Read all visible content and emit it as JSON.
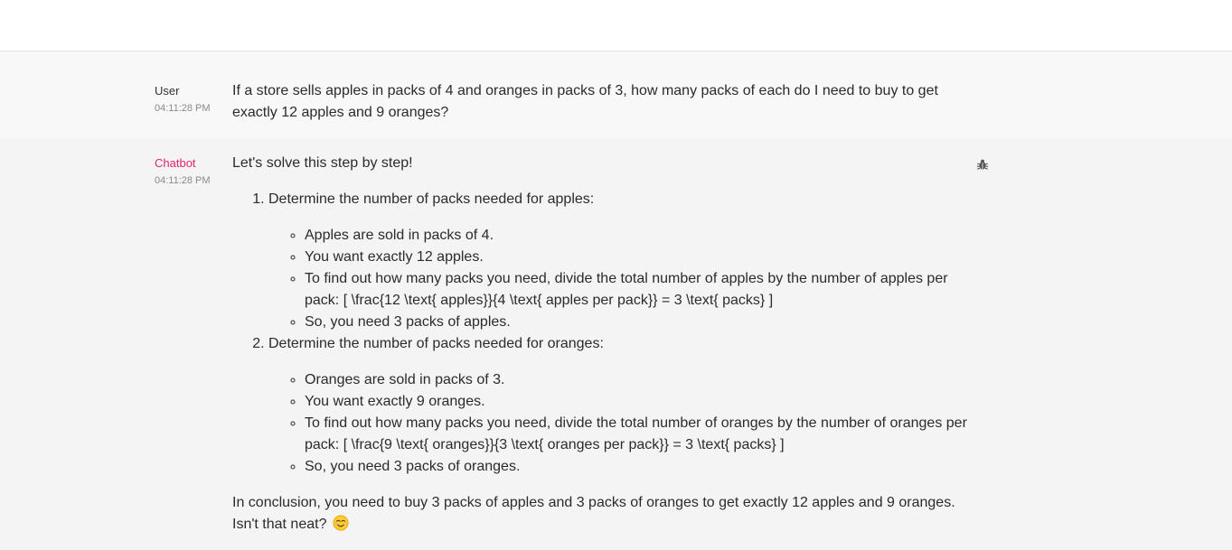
{
  "conversation": {
    "user_message": {
      "author": "User",
      "time": "04:11:28 PM",
      "text": "If a store sells apples in packs of 4 and oranges in packs of 3, how many packs of each do I need to buy to get exactly 12 apples and 9 oranges?"
    },
    "bot_message": {
      "author": "Chatbot",
      "time": "04:11:28 PM",
      "intro": "Let's solve this step by step!",
      "steps": [
        {
          "heading": "Determine the number of packs needed for apples:",
          "bullets": [
            "Apples are sold in packs of 4.",
            "You want exactly 12 apples.",
            "To find out how many packs you need, divide the total number of apples by the number of apples per pack: [ \\frac{12 \\text{ apples}}{4 \\text{ apples per pack}} = 3 \\text{ packs} ]",
            "So, you need 3 packs of apples."
          ]
        },
        {
          "heading": "Determine the number of packs needed for oranges:",
          "bullets": [
            "Oranges are sold in packs of 3.",
            "You want exactly 9 oranges.",
            "To find out how many packs you need, divide the total number of oranges by the number of oranges per pack: [ \\frac{9 \\text{ oranges}}{3 \\text{ oranges per pack}} = 3 \\text{ packs} ]",
            "So, you need 3 packs of oranges."
          ]
        }
      ],
      "conclusion": "In conclusion, you need to buy 3 packs of apples and 3 packs of oranges to get exactly 12 apples and 9 oranges. Isn't that neat?",
      "conclusion_emoji": "smiling-face-emoji",
      "action_icon": "bug-icon"
    }
  },
  "colors": {
    "bot_author": "#e0246f",
    "timestamp": "#8a8a8a",
    "text": "#2b2b2b"
  }
}
